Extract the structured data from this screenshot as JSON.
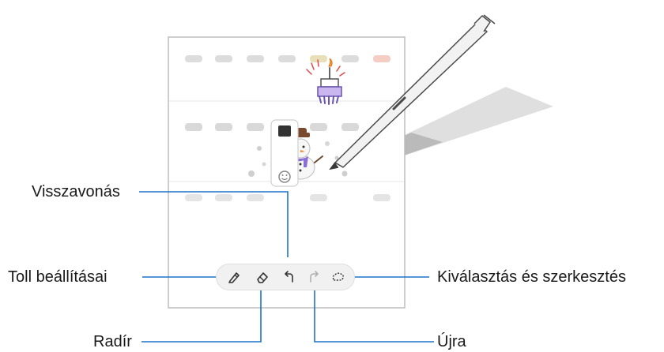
{
  "callouts": {
    "undo": "Visszavonás",
    "pen_settings": "Toll beállításai",
    "eraser": "Radír",
    "redo": "Újra",
    "selection_edit": "Kiválasztás és szerkesztés"
  },
  "toolbar": {
    "items": [
      {
        "icon": "pen-icon",
        "active": true
      },
      {
        "icon": "eraser-icon",
        "active": false
      },
      {
        "icon": "undo-icon",
        "active": false
      },
      {
        "icon": "redo-icon",
        "active": false,
        "disabled": true
      },
      {
        "icon": "lasso-select-icon",
        "active": false
      }
    ]
  },
  "colors": {
    "line": "#1e72c8",
    "text": "#1a1a1a",
    "stylus": "#f2f2f2",
    "doodle_purple": "#8a6fd8",
    "doodle_brown": "#7a4a2e"
  }
}
